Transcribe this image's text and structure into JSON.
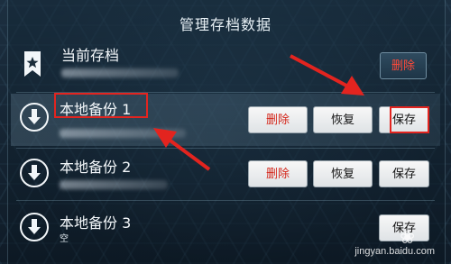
{
  "header": {
    "title": "管理存档数据"
  },
  "current_save": {
    "label": "当前存档",
    "delete_label": "删除"
  },
  "backups": [
    {
      "label": "本地备份 1",
      "delete_label": "删除",
      "restore_label": "恢复",
      "save_label": "保存"
    },
    {
      "label": "本地备份 2",
      "delete_label": "删除",
      "restore_label": "恢复",
      "save_label": "保存"
    },
    {
      "label": "本地备份 3",
      "sub": "空",
      "save_label": "保存"
    }
  ],
  "watermark": {
    "text": "jingyan.baidu.com"
  },
  "colors": {
    "annotation_red": "#e3241f",
    "delete_text": "#d4261a"
  },
  "icons": [
    "bookmark-star-icon",
    "download-arrow-icon"
  ]
}
